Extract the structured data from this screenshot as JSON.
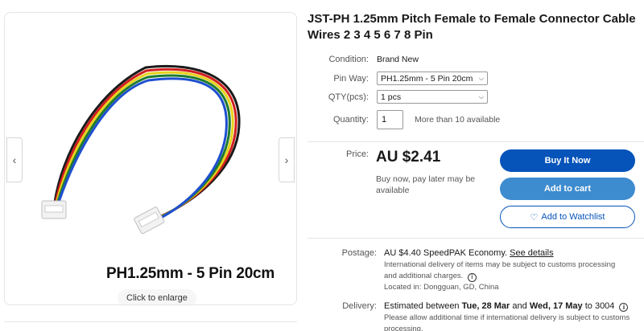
{
  "product": {
    "title": "JST-PH 1.25mm Pitch Female to Female Connector Cable Wires 2 3 4 5 6 7 8 Pin"
  },
  "gallery": {
    "caption": "PH1.25mm - 5 Pin 20cm",
    "enlarge_label": "Click to enlarge",
    "prev_icon": "chevron-left-icon",
    "next_icon": "chevron-right-icon",
    "wire_colors": [
      "#1a1a1a",
      "#d11f1f",
      "#e7d21c",
      "#1e7b2e",
      "#1e4fd0"
    ]
  },
  "details": {
    "condition_label": "Condition:",
    "condition_value": "Brand New",
    "pinway_label": "Pin Way:",
    "pinway_selected": "PH1.25mm - 5 Pin 20cm",
    "qty_label": "QTY(pcs):",
    "qty_selected": "1 pcs",
    "quantity_label": "Quantity:",
    "quantity_value": "1",
    "quantity_note": "More than 10 available"
  },
  "pricing": {
    "price_label": "Price:",
    "price_value": "AU $2.41",
    "bnpl_text": "Buy now, pay later may be available",
    "buy_now": "Buy It Now",
    "add_to_cart": "Add to cart",
    "add_to_watchlist": "Add to Watchlist"
  },
  "shipping": {
    "postage_label": "Postage:",
    "postage_text": "AU $4.40 SpeedPAK Economy.",
    "see_details": "See details",
    "customs_note": "International delivery of items may be subject to customs processing and additional charges.",
    "located_in": "Located in: Dongguan, GD, China",
    "delivery_label": "Delivery:",
    "delivery_prefix": "Estimated between",
    "delivery_start": "Tue, 28 Mar",
    "delivery_and": "and",
    "delivery_end": "Wed, 17 May",
    "delivery_to": "to 3004",
    "delivery_note": "Please allow additional time if international delivery is subject to customs processing."
  },
  "colors": {
    "buy_button": "#0654ba",
    "cart_button": "#3d8ccf"
  }
}
